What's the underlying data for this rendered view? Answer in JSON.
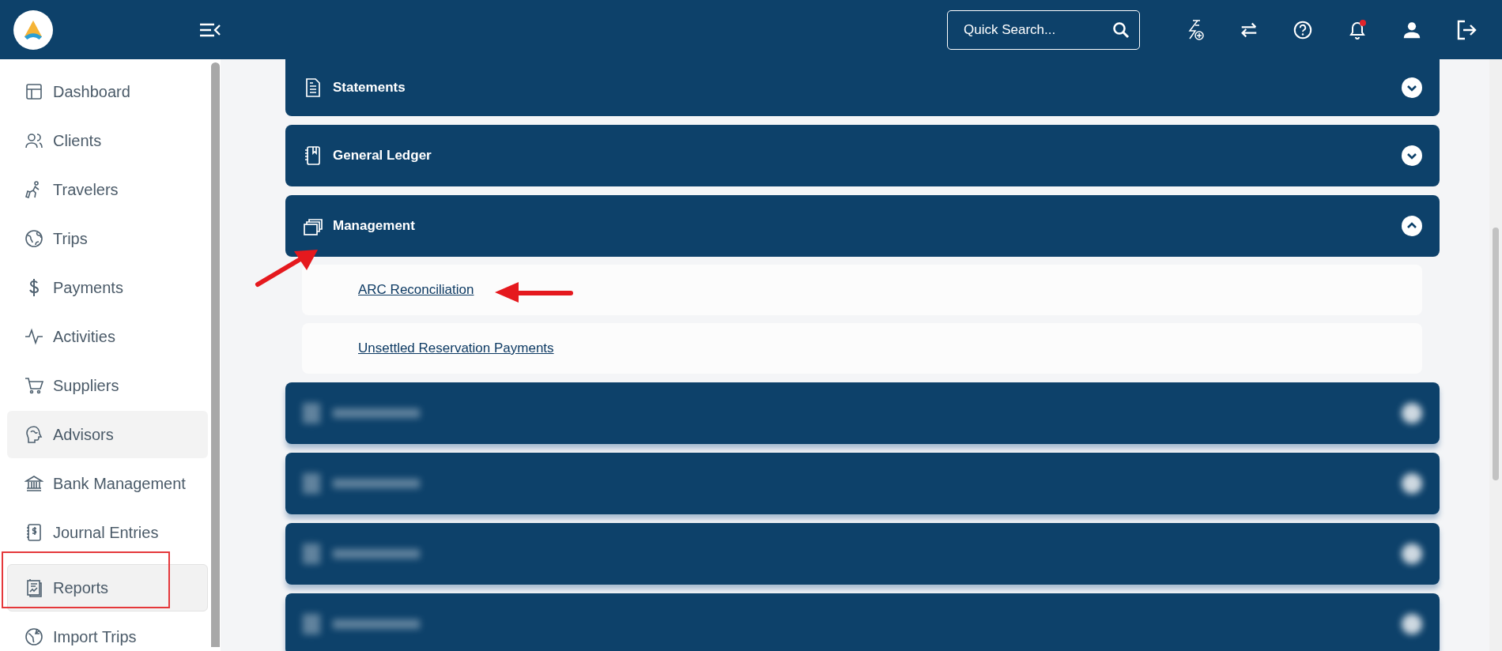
{
  "header": {
    "search": {
      "placeholder": "Quick Search..."
    },
    "notification_unread": true
  },
  "sidebar": {
    "items": [
      {
        "label": "Dashboard",
        "selected": false,
        "hovered": false
      },
      {
        "label": "Clients",
        "selected": false,
        "hovered": false
      },
      {
        "label": "Travelers",
        "selected": false,
        "hovered": false
      },
      {
        "label": "Trips",
        "selected": false,
        "hovered": false
      },
      {
        "label": "Payments",
        "selected": false,
        "hovered": false
      },
      {
        "label": "Activities",
        "selected": false,
        "hovered": false
      },
      {
        "label": "Suppliers",
        "selected": false,
        "hovered": false
      },
      {
        "label": "Advisors",
        "selected": false,
        "hovered": true
      },
      {
        "label": "Bank Management",
        "selected": false,
        "hovered": false
      },
      {
        "label": "Journal Entries",
        "selected": false,
        "hovered": false
      },
      {
        "label": "Reports",
        "selected": true,
        "hovered": false
      },
      {
        "label": "Import Trips",
        "selected": false,
        "hovered": false
      }
    ]
  },
  "sections": [
    {
      "kind": "section",
      "title": "Statements",
      "expanded": false
    },
    {
      "kind": "section",
      "title": "General Ledger",
      "expanded": false
    },
    {
      "kind": "section",
      "title": "Management",
      "expanded": true,
      "links": [
        "ARC Reconciliation",
        "Unsettled Reservation Payments"
      ]
    },
    {
      "kind": "blurred"
    },
    {
      "kind": "blurred"
    },
    {
      "kind": "blurred"
    },
    {
      "kind": "blurred"
    }
  ]
}
